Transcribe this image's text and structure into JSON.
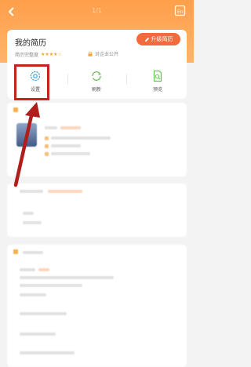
{
  "header": {
    "pager": "1/1"
  },
  "card": {
    "title": "我的简历",
    "upgrade_label": "升级简历",
    "completeness_label": "简历完整度",
    "stars": "★★★★☆",
    "visibility_label": "对企业公开"
  },
  "actions": [
    {
      "label": "设置",
      "icon": "gear-icon"
    },
    {
      "label": "刷新",
      "icon": "refresh-icon"
    },
    {
      "label": "预览",
      "icon": "preview-icon"
    }
  ],
  "colors": {
    "brand": "#f36b3a",
    "header": "#ff9f4a",
    "highlight": "#c2231f",
    "icon_blue": "#3fa3d8",
    "icon_green": "#6bbf5a"
  }
}
